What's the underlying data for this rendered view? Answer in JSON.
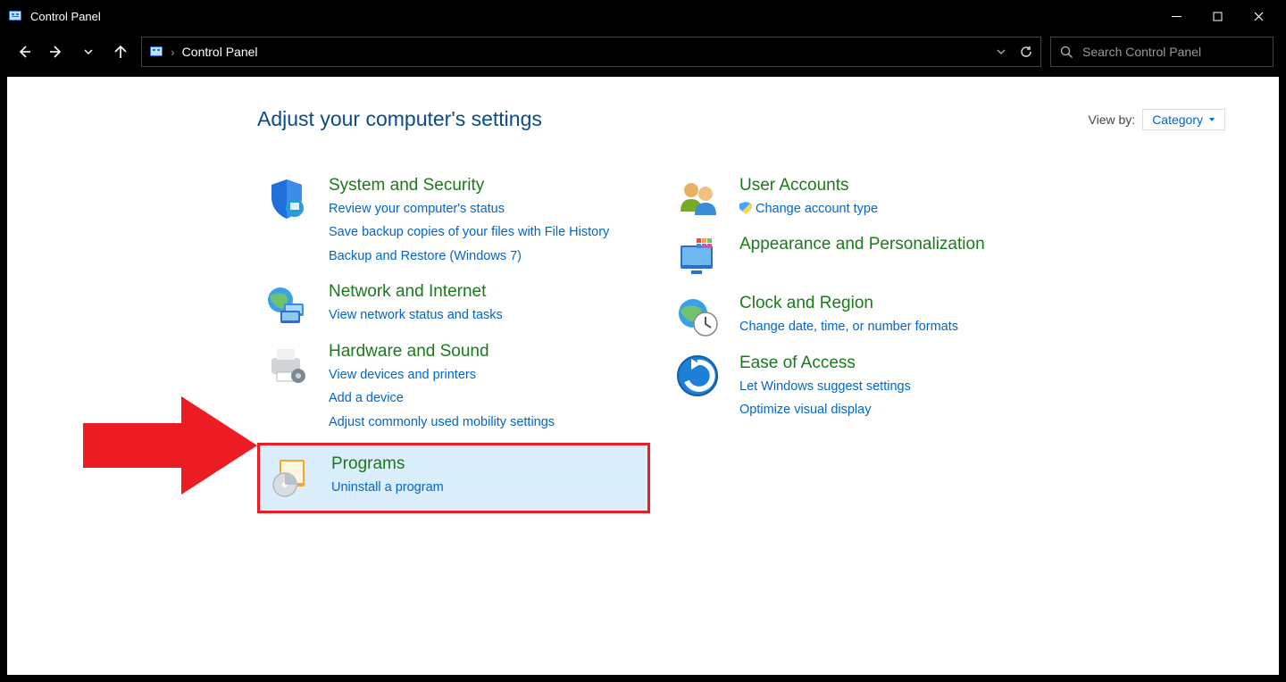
{
  "window": {
    "title": "Control Panel",
    "breadcrumb": "Control Panel"
  },
  "search": {
    "placeholder": "Search Control Panel"
  },
  "main": {
    "heading": "Adjust your computer's settings",
    "viewby_label": "View by:",
    "viewby_value": "Category"
  },
  "categories": {
    "left": [
      {
        "title": "System and Security",
        "links": [
          "Review your computer's status",
          "Save backup copies of your files with File History",
          "Backup and Restore (Windows 7)"
        ],
        "icon": "shield-monitor"
      },
      {
        "title": "Network and Internet",
        "links": [
          "View network status and tasks"
        ],
        "icon": "globe-network"
      },
      {
        "title": "Hardware and Sound",
        "links": [
          "View devices and printers",
          "Add a device",
          "Adjust commonly used mobility settings"
        ],
        "icon": "printer"
      },
      {
        "title": "Programs",
        "links": [
          "Uninstall a program"
        ],
        "icon": "disc-box",
        "highlighted": true
      }
    ],
    "right": [
      {
        "title": "User Accounts",
        "links": [
          "Change account type"
        ],
        "shield_on": [
          0
        ],
        "icon": "people"
      },
      {
        "title": "Appearance and Personalization",
        "links": [],
        "icon": "monitor-colors"
      },
      {
        "title": "Clock and Region",
        "links": [
          "Change date, time, or number formats"
        ],
        "icon": "globe-clock"
      },
      {
        "title": "Ease of Access",
        "links": [
          "Let Windows suggest settings",
          "Optimize visual display"
        ],
        "icon": "ease-arrow"
      }
    ]
  }
}
